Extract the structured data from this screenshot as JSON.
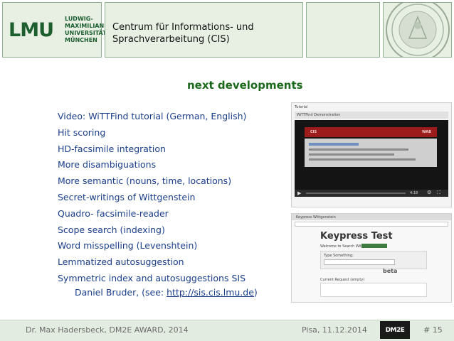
{
  "header": {
    "logo_text": "LMU",
    "logo_lines": [
      "LUDWIG-",
      "MAXIMILIANS-",
      "UNIVERSITÄT",
      "MÜNCHEN"
    ],
    "title_line1": "Centrum für Informations- und",
    "title_line2": "Sprachverarbeitung (CIS)"
  },
  "slide": {
    "title": "next developments",
    "bullets": [
      "Video: WiTTFind tutorial (German, English)",
      "Hit scoring",
      "HD-facsimile integration",
      "More disambiguations",
      "More semantic  (nouns, time, locations)",
      "Secret-writings of Wittgenstein",
      "Quadro- facsimile-reader",
      "Scope search (indexing)",
      "Word misspelling (Levenshtein)",
      "Lemmatized autosuggestion",
      "Symmetric index and autosuggestions SIS"
    ],
    "sub_prefix": "Daniel Bruder, (see: ",
    "sub_link": "http://sis.cis.lmu.de",
    "sub_suffix": ")"
  },
  "video": {
    "tab_label": "Tutorial",
    "page_label": "WiTTFind Demonstration",
    "banner_left": "CIS",
    "banner_right": "WAB",
    "time": "4:18"
  },
  "keypress": {
    "tab_label": "Keypress Wittgenstein",
    "heading": "Keypress Test",
    "welcome": "Welcome to Search Wittgenstein",
    "field_label": "Type Something:",
    "badge": "beta",
    "current_label": "Current Request (empty)"
  },
  "footer": {
    "author": "Dr. Max Hadersbeck, DM2E AWARD, 2014",
    "date": "Pisa, 11.12.2014",
    "logo": "DM2E",
    "page": "# 15"
  },
  "colors": {
    "header_bg": "#e8f0e4",
    "accent_green": "#1b6a1b",
    "bullet_blue": "#1a3e8a",
    "footer_bg": "#e3ece0"
  }
}
